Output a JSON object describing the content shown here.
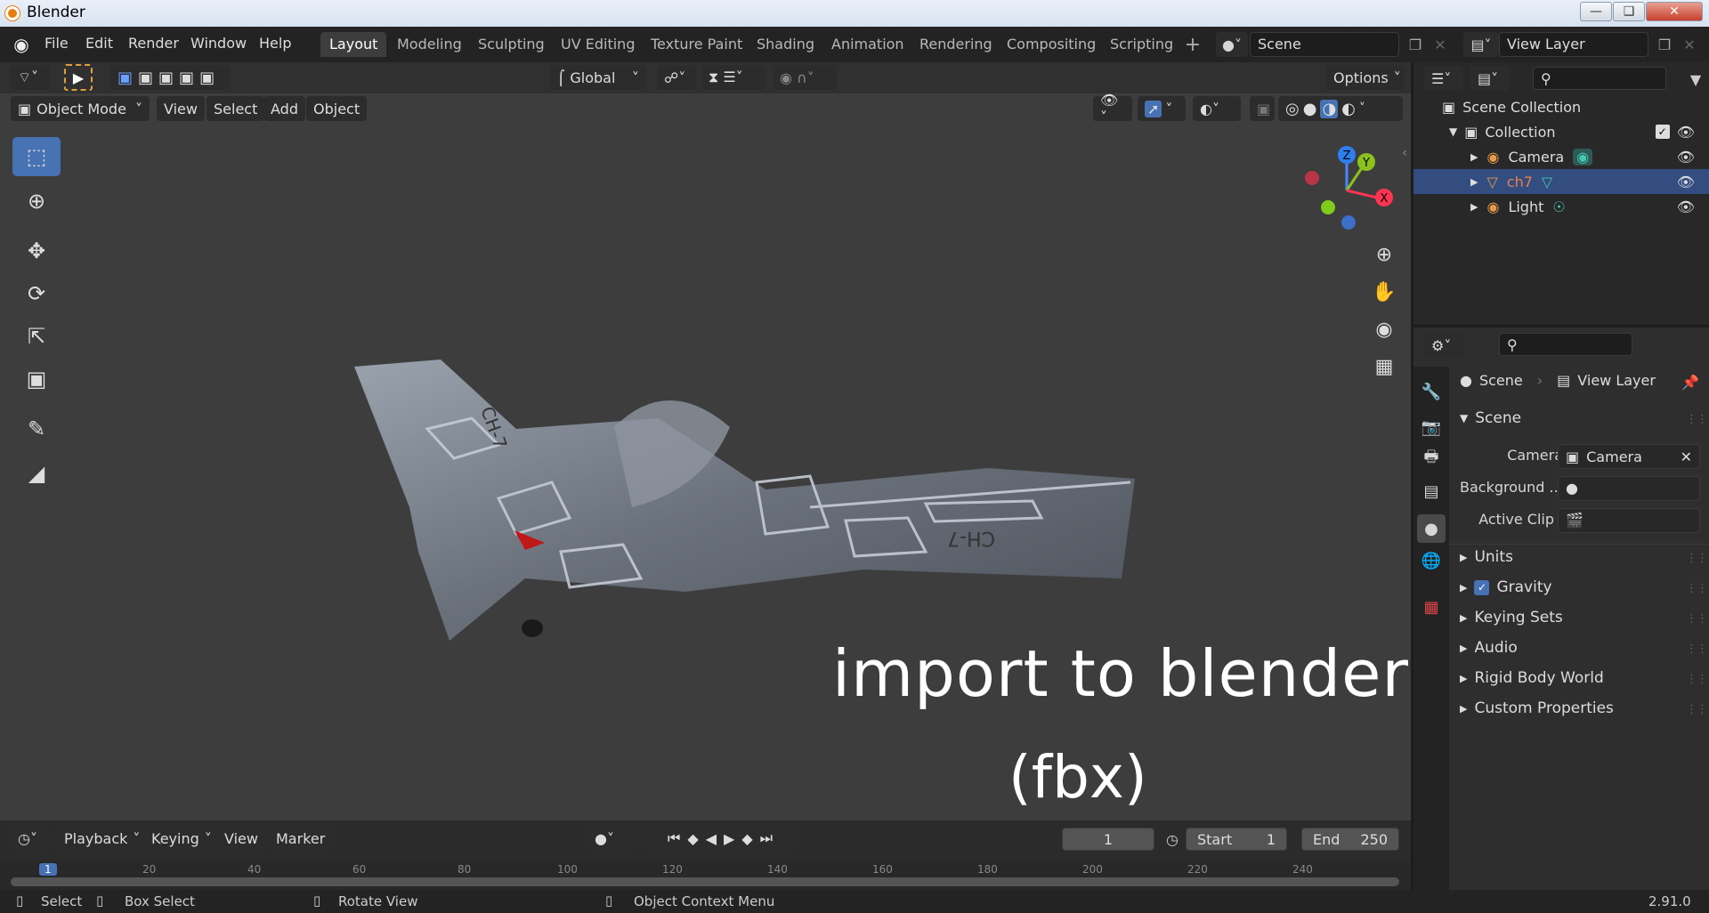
{
  "window": {
    "title": "Blender"
  },
  "menu": {
    "items": [
      "File",
      "Edit",
      "Render",
      "Window",
      "Help"
    ]
  },
  "workspaces": [
    "Layout",
    "Modeling",
    "Sculpting",
    "UV Editing",
    "Texture Paint",
    "Shading",
    "Animation",
    "Rendering",
    "Compositing",
    "Scripting"
  ],
  "active_workspace": "Layout",
  "scene_field": "Scene",
  "view_layer_field": "View Layer",
  "viewport": {
    "transform_orientation": "Global",
    "options_label": "Options",
    "mode": "Object Mode",
    "header_menus": [
      "View",
      "Select",
      "Add",
      "Object"
    ],
    "gizmo": {
      "x": "X",
      "y": "Y",
      "z": "Z"
    },
    "fuselage_text": "CH-7",
    "wing_text": "CH-7",
    "overlay_line1": "import to blender",
    "overlay_line2": "(fbx)"
  },
  "outliner": {
    "root": "Scene Collection",
    "collection": "Collection",
    "objects": [
      {
        "name": "Camera",
        "color": "#dddddd"
      },
      {
        "name": "ch7",
        "color": "#e8814a"
      },
      {
        "name": "Light",
        "color": "#dddddd"
      }
    ]
  },
  "properties": {
    "breadcrumb_scene": "Scene",
    "breadcrumb_layer": "View Layer",
    "section": "Scene",
    "camera_label": "Camera",
    "camera_value": "Camera",
    "background_label": "Background ...",
    "active_clip_label": "Active Clip",
    "panels": [
      "Units",
      "Gravity",
      "Keying Sets",
      "Audio",
      "Rigid Body World",
      "Custom Properties"
    ]
  },
  "timeline": {
    "menus": [
      "Playback",
      "Keying",
      "View",
      "Marker"
    ],
    "current_frame": "1",
    "start_label": "Start",
    "start_value": "1",
    "end_label": "End",
    "end_value": "250",
    "ruler": [
      "1",
      "20",
      "40",
      "60",
      "80",
      "100",
      "120",
      "140",
      "160",
      "180",
      "200",
      "220",
      "240"
    ]
  },
  "status": {
    "select": "Select",
    "box_select": "Box Select",
    "rotate_view": "Rotate View",
    "context_menu": "Object Context Menu",
    "version": "2.91.0"
  },
  "colors": {
    "accent": "#4772b3",
    "selection_row": "#334d80",
    "header_bg": "#232323"
  }
}
